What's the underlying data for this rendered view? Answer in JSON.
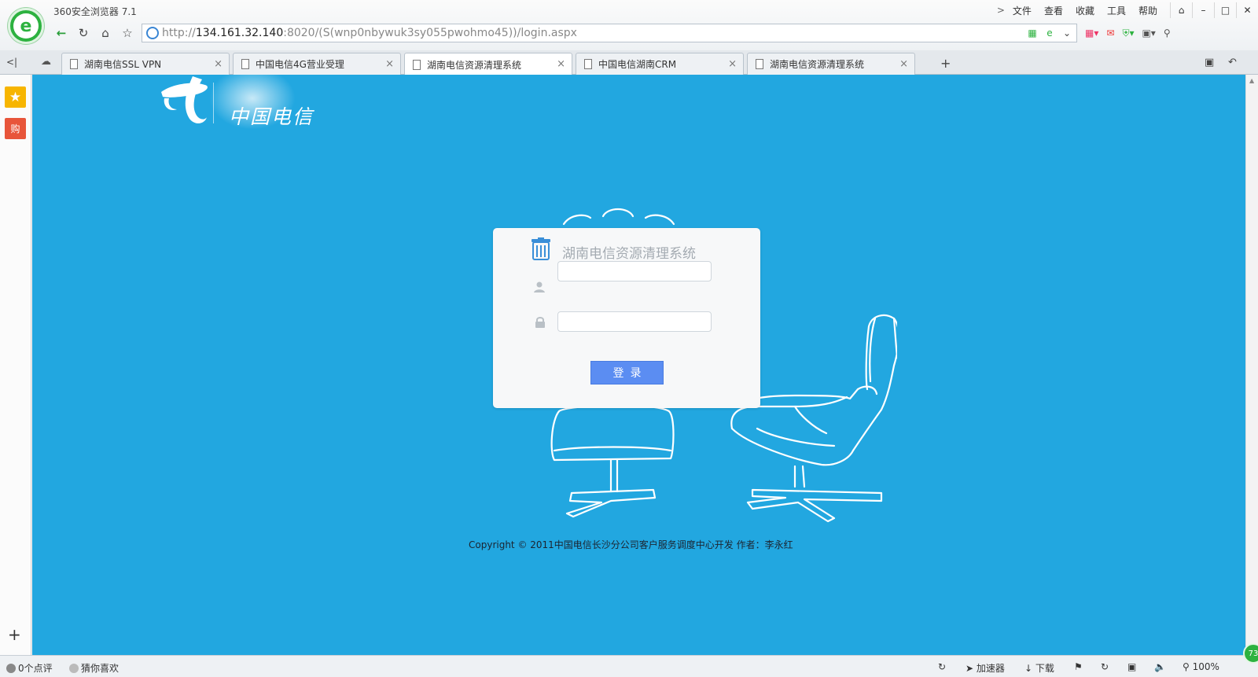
{
  "browser": {
    "title": "360安全浏览器 7.1",
    "menu": [
      "文件",
      "查看",
      "收藏",
      "工具",
      "帮助"
    ],
    "window_buttons": [
      "⌂",
      "–",
      "□",
      "✕"
    ]
  },
  "address": {
    "prefix": "http://",
    "host": "134.161.32.140",
    "rest": ":8020/(S(wnp0nbywuk3sy055pwohmo45))/login.aspx"
  },
  "tabs": [
    {
      "label": "湖南电信SSL VPN",
      "active": false
    },
    {
      "label": "中国电信4G营业受理",
      "active": false
    },
    {
      "label": "湖南电信资源清理系统",
      "active": true
    },
    {
      "label": "中国电信湖南CRM",
      "active": false
    },
    {
      "label": "湖南电信资源清理系统",
      "active": false
    }
  ],
  "sidebar": {
    "shop_label": "购"
  },
  "page": {
    "brand_name": "中国电信",
    "system_title": "湖南电信资源清理系统",
    "username_value": "",
    "password_value": "",
    "login_label": "登录",
    "copyright": "Copyright © 2011中国电信长沙分公司客户服务调度中心开发 作者：李永红"
  },
  "status": {
    "comments": "0个点评",
    "guess": "猜你喜欢",
    "accelerator": "加速器",
    "download": "下载",
    "zoom": "100%",
    "badge": "73"
  },
  "colors": {
    "page_bg": "#22a7e0",
    "login_button": "#5b8df2",
    "brand_green": "#2db240"
  }
}
